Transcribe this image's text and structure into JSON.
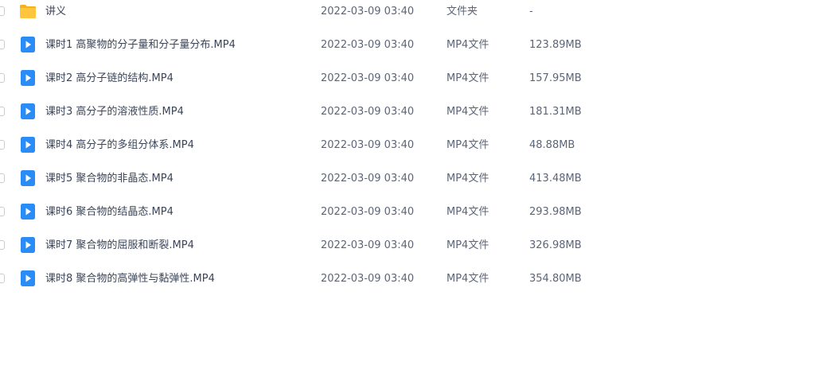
{
  "files": [
    {
      "icon": "folder-icon",
      "name": "讲义",
      "date": "2022-03-09 03:40",
      "type": "文件夹",
      "size": "-"
    },
    {
      "icon": "video-file-icon",
      "name": "课时1 高聚物的分子量和分子量分布.MP4",
      "date": "2022-03-09 03:40",
      "type": "MP4文件",
      "size": "123.89MB"
    },
    {
      "icon": "video-file-icon",
      "name": "课时2 高分子链的结构.MP4",
      "date": "2022-03-09 03:40",
      "type": "MP4文件",
      "size": "157.95MB"
    },
    {
      "icon": "video-file-icon",
      "name": "课时3 高分子的溶液性质.MP4",
      "date": "2022-03-09 03:40",
      "type": "MP4文件",
      "size": "181.31MB"
    },
    {
      "icon": "video-file-icon",
      "name": "课时4 高分子的多组分体系.MP4",
      "date": "2022-03-09 03:40",
      "type": "MP4文件",
      "size": "48.88MB"
    },
    {
      "icon": "video-file-icon",
      "name": "课时5 聚合物的非晶态.MP4",
      "date": "2022-03-09 03:40",
      "type": "MP4文件",
      "size": "413.48MB"
    },
    {
      "icon": "video-file-icon",
      "name": "课时6 聚合物的结晶态.MP4",
      "date": "2022-03-09 03:40",
      "type": "MP4文件",
      "size": "293.98MB"
    },
    {
      "icon": "video-file-icon",
      "name": "课时7 聚合物的屈服和断裂.MP4",
      "date": "2022-03-09 03:40",
      "type": "MP4文件",
      "size": "326.98MB"
    },
    {
      "icon": "video-file-icon",
      "name": "课时8 聚合物的高弹性与黏弹性.MP4",
      "date": "2022-03-09 03:40",
      "type": "MP4文件",
      "size": "354.80MB"
    }
  ],
  "colors": {
    "folder": "#ffc53d",
    "folder_tab": "#f7b21a",
    "video": "#2a8cf6",
    "checkbox_border": "#c8ccd4"
  }
}
